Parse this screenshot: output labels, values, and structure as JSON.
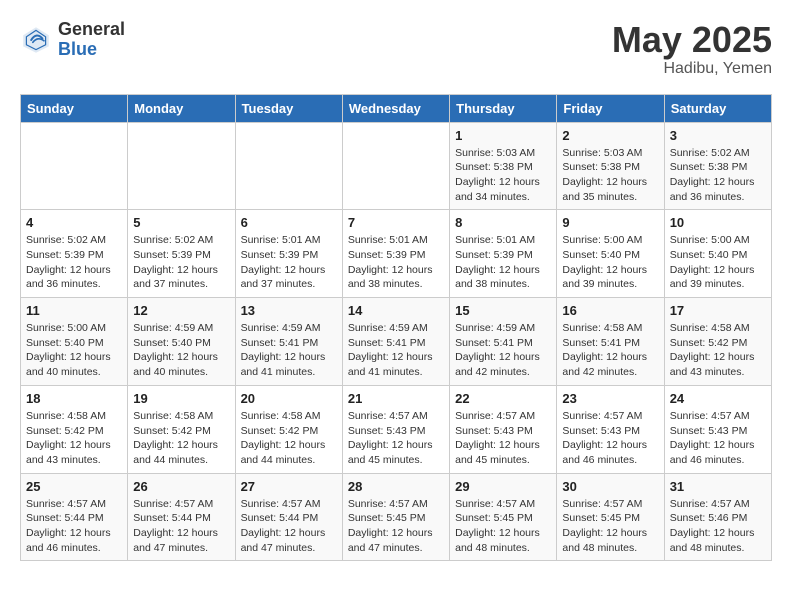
{
  "logo": {
    "general": "General",
    "blue": "Blue"
  },
  "title": {
    "month_year": "May 2025",
    "location": "Hadibu, Yemen"
  },
  "weekdays": [
    "Sunday",
    "Monday",
    "Tuesday",
    "Wednesday",
    "Thursday",
    "Friday",
    "Saturday"
  ],
  "weeks": [
    [
      {
        "day": "",
        "info": ""
      },
      {
        "day": "",
        "info": ""
      },
      {
        "day": "",
        "info": ""
      },
      {
        "day": "",
        "info": ""
      },
      {
        "day": "1",
        "info": "Sunrise: 5:03 AM\nSunset: 5:38 PM\nDaylight: 12 hours\nand 34 minutes."
      },
      {
        "day": "2",
        "info": "Sunrise: 5:03 AM\nSunset: 5:38 PM\nDaylight: 12 hours\nand 35 minutes."
      },
      {
        "day": "3",
        "info": "Sunrise: 5:02 AM\nSunset: 5:38 PM\nDaylight: 12 hours\nand 36 minutes."
      }
    ],
    [
      {
        "day": "4",
        "info": "Sunrise: 5:02 AM\nSunset: 5:39 PM\nDaylight: 12 hours\nand 36 minutes."
      },
      {
        "day": "5",
        "info": "Sunrise: 5:02 AM\nSunset: 5:39 PM\nDaylight: 12 hours\nand 37 minutes."
      },
      {
        "day": "6",
        "info": "Sunrise: 5:01 AM\nSunset: 5:39 PM\nDaylight: 12 hours\nand 37 minutes."
      },
      {
        "day": "7",
        "info": "Sunrise: 5:01 AM\nSunset: 5:39 PM\nDaylight: 12 hours\nand 38 minutes."
      },
      {
        "day": "8",
        "info": "Sunrise: 5:01 AM\nSunset: 5:39 PM\nDaylight: 12 hours\nand 38 minutes."
      },
      {
        "day": "9",
        "info": "Sunrise: 5:00 AM\nSunset: 5:40 PM\nDaylight: 12 hours\nand 39 minutes."
      },
      {
        "day": "10",
        "info": "Sunrise: 5:00 AM\nSunset: 5:40 PM\nDaylight: 12 hours\nand 39 minutes."
      }
    ],
    [
      {
        "day": "11",
        "info": "Sunrise: 5:00 AM\nSunset: 5:40 PM\nDaylight: 12 hours\nand 40 minutes."
      },
      {
        "day": "12",
        "info": "Sunrise: 4:59 AM\nSunset: 5:40 PM\nDaylight: 12 hours\nand 40 minutes."
      },
      {
        "day": "13",
        "info": "Sunrise: 4:59 AM\nSunset: 5:41 PM\nDaylight: 12 hours\nand 41 minutes."
      },
      {
        "day": "14",
        "info": "Sunrise: 4:59 AM\nSunset: 5:41 PM\nDaylight: 12 hours\nand 41 minutes."
      },
      {
        "day": "15",
        "info": "Sunrise: 4:59 AM\nSunset: 5:41 PM\nDaylight: 12 hours\nand 42 minutes."
      },
      {
        "day": "16",
        "info": "Sunrise: 4:58 AM\nSunset: 5:41 PM\nDaylight: 12 hours\nand 42 minutes."
      },
      {
        "day": "17",
        "info": "Sunrise: 4:58 AM\nSunset: 5:42 PM\nDaylight: 12 hours\nand 43 minutes."
      }
    ],
    [
      {
        "day": "18",
        "info": "Sunrise: 4:58 AM\nSunset: 5:42 PM\nDaylight: 12 hours\nand 43 minutes."
      },
      {
        "day": "19",
        "info": "Sunrise: 4:58 AM\nSunset: 5:42 PM\nDaylight: 12 hours\nand 44 minutes."
      },
      {
        "day": "20",
        "info": "Sunrise: 4:58 AM\nSunset: 5:42 PM\nDaylight: 12 hours\nand 44 minutes."
      },
      {
        "day": "21",
        "info": "Sunrise: 4:57 AM\nSunset: 5:43 PM\nDaylight: 12 hours\nand 45 minutes."
      },
      {
        "day": "22",
        "info": "Sunrise: 4:57 AM\nSunset: 5:43 PM\nDaylight: 12 hours\nand 45 minutes."
      },
      {
        "day": "23",
        "info": "Sunrise: 4:57 AM\nSunset: 5:43 PM\nDaylight: 12 hours\nand 46 minutes."
      },
      {
        "day": "24",
        "info": "Sunrise: 4:57 AM\nSunset: 5:43 PM\nDaylight: 12 hours\nand 46 minutes."
      }
    ],
    [
      {
        "day": "25",
        "info": "Sunrise: 4:57 AM\nSunset: 5:44 PM\nDaylight: 12 hours\nand 46 minutes."
      },
      {
        "day": "26",
        "info": "Sunrise: 4:57 AM\nSunset: 5:44 PM\nDaylight: 12 hours\nand 47 minutes."
      },
      {
        "day": "27",
        "info": "Sunrise: 4:57 AM\nSunset: 5:44 PM\nDaylight: 12 hours\nand 47 minutes."
      },
      {
        "day": "28",
        "info": "Sunrise: 4:57 AM\nSunset: 5:45 PM\nDaylight: 12 hours\nand 47 minutes."
      },
      {
        "day": "29",
        "info": "Sunrise: 4:57 AM\nSunset: 5:45 PM\nDaylight: 12 hours\nand 48 minutes."
      },
      {
        "day": "30",
        "info": "Sunrise: 4:57 AM\nSunset: 5:45 PM\nDaylight: 12 hours\nand 48 minutes."
      },
      {
        "day": "31",
        "info": "Sunrise: 4:57 AM\nSunset: 5:46 PM\nDaylight: 12 hours\nand 48 minutes."
      }
    ]
  ]
}
